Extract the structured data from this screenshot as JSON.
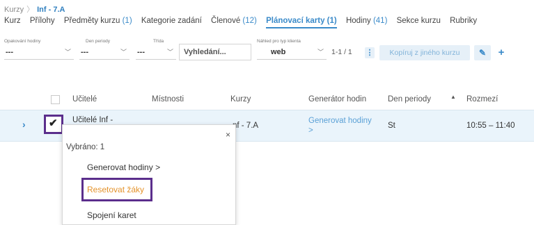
{
  "breadcrumb": {
    "root": "Kurzy",
    "current": "Inf - 7.A"
  },
  "tabs": [
    {
      "label": "Kurz",
      "count": ""
    },
    {
      "label": "Přílohy",
      "count": ""
    },
    {
      "label": "Předměty kurzu",
      "count": "(1)"
    },
    {
      "label": "Kategorie zadání",
      "count": ""
    },
    {
      "label": "Členové",
      "count": "(12)"
    },
    {
      "label": "Plánovací karty",
      "count": "(1)",
      "active": true
    },
    {
      "label": "Hodiny",
      "count": "(41)"
    },
    {
      "label": "Sekce kurzu",
      "count": ""
    },
    {
      "label": "Rubriky",
      "count": ""
    }
  ],
  "filters": {
    "repeat": {
      "label": "Opakování hodiny",
      "value": "---"
    },
    "period_day": {
      "label": "Den periody",
      "value": "---"
    },
    "class": {
      "label": "Třída",
      "value": "---"
    },
    "search_placeholder": "Vyhledání...",
    "client_view": {
      "label": "Náhled pro typ klienta",
      "value": "web"
    },
    "pagination": "1-1 / 1",
    "copy_button": "Kopíruj z jiného kurzu"
  },
  "table": {
    "columns": [
      "Učitelé",
      "Místnosti",
      "Kurzy",
      "Generátor hodin",
      "Den periody",
      "Rozmezí"
    ],
    "row": {
      "teachers": "Učitelé Inf -",
      "course": "nf - 7.A",
      "generator_line1": "Generovat hodiny",
      "generator_line2": ">",
      "day": "St",
      "range": "10:55 – 11:40"
    }
  },
  "popup": {
    "close_icon": "×",
    "selected": "Vybráno: 1",
    "items": [
      "Generovat hodiny >",
      "Resetovat žáky",
      "Spojení karet"
    ]
  },
  "colors": {
    "accent": "#3a8ac9",
    "highlight": "#5b2e8c",
    "reset": "#e4932b"
  }
}
